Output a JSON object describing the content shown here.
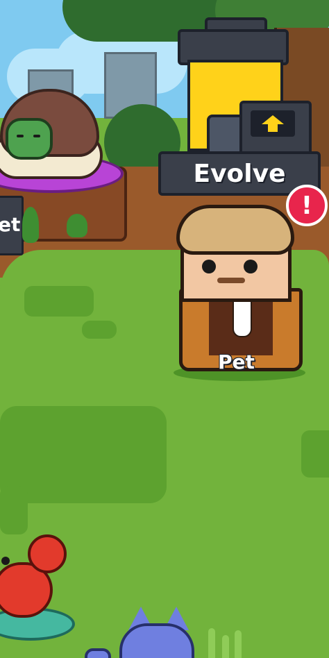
{
  "machine": {
    "evolve_label": "Evolve",
    "alert_symbol": "!",
    "arrow_icon": "up-arrow-icon"
  },
  "pen": {
    "sign_label": "et"
  },
  "pet": {
    "name_label": "Pet"
  },
  "colors": {
    "grass": "#72b33c",
    "evolve_tank": "#ffd21a",
    "alert_badge": "#e8254c",
    "pen_ring": "#b844d6"
  }
}
